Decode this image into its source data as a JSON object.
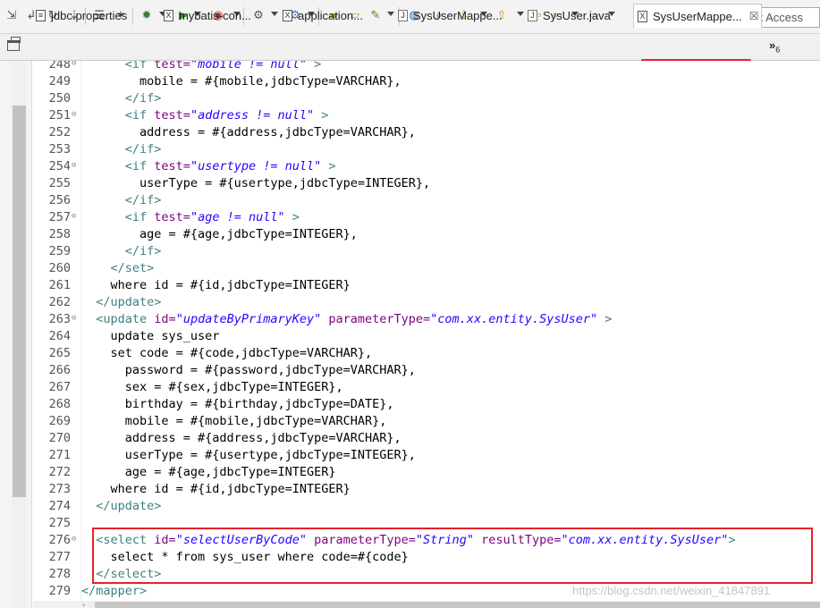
{
  "toolbar": {
    "quick_access_placeholder": "Quick Access"
  },
  "tabs": [
    {
      "label": "jdbc.properties",
      "icon": "properties-file-icon",
      "active": false
    },
    {
      "label": "mybatis-con...",
      "icon": "xml-file-icon",
      "active": false
    },
    {
      "label": "application...",
      "icon": "xml-file-icon",
      "active": false
    },
    {
      "label": "SysUserMappe...",
      "icon": "java-file-icon",
      "active": false
    },
    {
      "label": "SysUser.java",
      "icon": "java-file-icon",
      "active": false
    },
    {
      "label": "SysUserMappe...",
      "icon": "xml-file-icon",
      "active": true
    }
  ],
  "tab_close_glyph": "☒",
  "overflow_tabs": {
    "glyph": "»",
    "count": "6"
  },
  "editor": {
    "lines": [
      {
        "n": "248",
        "fold": true,
        "parts": [
          [
            "ws",
            "      "
          ],
          [
            "tag",
            "<if "
          ],
          [
            "attr",
            "test="
          ],
          [
            "val",
            "\"mobile != null\""
          ],
          [
            "tag",
            " >"
          ]
        ]
      },
      {
        "n": "249",
        "fold": false,
        "parts": [
          [
            "text",
            "        mobile = #{mobile,jdbcType=VARCHAR},"
          ]
        ]
      },
      {
        "n": "250",
        "fold": false,
        "parts": [
          [
            "ws",
            "      "
          ],
          [
            "tag",
            "</if>"
          ]
        ]
      },
      {
        "n": "251",
        "fold": true,
        "parts": [
          [
            "ws",
            "      "
          ],
          [
            "tag",
            "<if "
          ],
          [
            "attr",
            "test="
          ],
          [
            "val",
            "\"address != null\""
          ],
          [
            "tag",
            " >"
          ]
        ]
      },
      {
        "n": "252",
        "fold": false,
        "parts": [
          [
            "text",
            "        address = #{address,jdbcType=VARCHAR},"
          ]
        ]
      },
      {
        "n": "253",
        "fold": false,
        "parts": [
          [
            "ws",
            "      "
          ],
          [
            "tag",
            "</if>"
          ]
        ]
      },
      {
        "n": "254",
        "fold": true,
        "parts": [
          [
            "ws",
            "      "
          ],
          [
            "tag",
            "<if "
          ],
          [
            "attr",
            "test="
          ],
          [
            "val",
            "\"usertype != null\""
          ],
          [
            "tag",
            " >"
          ]
        ]
      },
      {
        "n": "255",
        "fold": false,
        "parts": [
          [
            "text",
            "        userType = #{usertype,jdbcType=INTEGER},"
          ]
        ]
      },
      {
        "n": "256",
        "fold": false,
        "parts": [
          [
            "ws",
            "      "
          ],
          [
            "tag",
            "</if>"
          ]
        ]
      },
      {
        "n": "257",
        "fold": true,
        "parts": [
          [
            "ws",
            "      "
          ],
          [
            "tag",
            "<if "
          ],
          [
            "attr",
            "test="
          ],
          [
            "val",
            "\"age != null\""
          ],
          [
            "tag",
            " >"
          ]
        ]
      },
      {
        "n": "258",
        "fold": false,
        "parts": [
          [
            "text",
            "        age = #{age,jdbcType=INTEGER},"
          ]
        ]
      },
      {
        "n": "259",
        "fold": false,
        "parts": [
          [
            "ws",
            "      "
          ],
          [
            "tag",
            "</if>"
          ]
        ]
      },
      {
        "n": "260",
        "fold": false,
        "parts": [
          [
            "ws",
            "    "
          ],
          [
            "tag",
            "</set>"
          ]
        ]
      },
      {
        "n": "261",
        "fold": false,
        "parts": [
          [
            "text",
            "    where id = #{id,jdbcType=INTEGER}"
          ]
        ]
      },
      {
        "n": "262",
        "fold": false,
        "parts": [
          [
            "ws",
            "  "
          ],
          [
            "tag",
            "</update>"
          ]
        ]
      },
      {
        "n": "263",
        "fold": true,
        "parts": [
          [
            "ws",
            "  "
          ],
          [
            "tag",
            "<update "
          ],
          [
            "attr",
            "id="
          ],
          [
            "val",
            "\"updateByPrimaryKey\""
          ],
          [
            "attr",
            " parameterType="
          ],
          [
            "val",
            "\"com.xx.entity.SysUser\""
          ],
          [
            "tag",
            " >"
          ]
        ]
      },
      {
        "n": "264",
        "fold": false,
        "parts": [
          [
            "text",
            "    update sys_user"
          ]
        ]
      },
      {
        "n": "265",
        "fold": false,
        "parts": [
          [
            "text",
            "    set code = #{code,jdbcType=VARCHAR},"
          ]
        ]
      },
      {
        "n": "266",
        "fold": false,
        "parts": [
          [
            "text",
            "      password = #{password,jdbcType=VARCHAR},"
          ]
        ]
      },
      {
        "n": "267",
        "fold": false,
        "parts": [
          [
            "text",
            "      sex = #{sex,jdbcType=INTEGER},"
          ]
        ]
      },
      {
        "n": "268",
        "fold": false,
        "parts": [
          [
            "text",
            "      birthday = #{birthday,jdbcType=DATE},"
          ]
        ]
      },
      {
        "n": "269",
        "fold": false,
        "parts": [
          [
            "text",
            "      mobile = #{mobile,jdbcType=VARCHAR},"
          ]
        ]
      },
      {
        "n": "270",
        "fold": false,
        "parts": [
          [
            "text",
            "      address = #{address,jdbcType=VARCHAR},"
          ]
        ]
      },
      {
        "n": "271",
        "fold": false,
        "parts": [
          [
            "text",
            "      userType = #{usertype,jdbcType=INTEGER},"
          ]
        ]
      },
      {
        "n": "272",
        "fold": false,
        "parts": [
          [
            "text",
            "      age = #{age,jdbcType=INTEGER}"
          ]
        ]
      },
      {
        "n": "273",
        "fold": false,
        "parts": [
          [
            "text",
            "    where id = #{id,jdbcType=INTEGER}"
          ]
        ]
      },
      {
        "n": "274",
        "fold": false,
        "parts": [
          [
            "ws",
            "  "
          ],
          [
            "tag",
            "</update>"
          ]
        ]
      },
      {
        "n": "275",
        "fold": false,
        "parts": []
      },
      {
        "n": "276",
        "fold": true,
        "parts": [
          [
            "ws",
            "  "
          ],
          [
            "tag",
            "<select "
          ],
          [
            "attr",
            "id="
          ],
          [
            "val",
            "\"selectUserByCode\""
          ],
          [
            "attr",
            " parameterType="
          ],
          [
            "val",
            "\"String\""
          ],
          [
            "attr",
            " resultType="
          ],
          [
            "val",
            "\"com.xx.entity.SysUser\""
          ],
          [
            "tag",
            ">"
          ]
        ]
      },
      {
        "n": "277",
        "fold": false,
        "parts": [
          [
            "text",
            "    select * from sys_user where code=#{code}"
          ]
        ]
      },
      {
        "n": "278",
        "fold": false,
        "parts": [
          [
            "ws",
            "  "
          ],
          [
            "tag",
            "</select>"
          ]
        ]
      },
      {
        "n": "279",
        "fold": false,
        "parts": [
          [
            "tag",
            "</mapper>"
          ]
        ]
      }
    ]
  },
  "watermark": "https://blog.csdn.net/weixin_41847891",
  "colors": {
    "tag": "#3f7f7f",
    "attribute": "#7f007f",
    "value": "#2a00ff",
    "highlight": "#e8212a"
  }
}
